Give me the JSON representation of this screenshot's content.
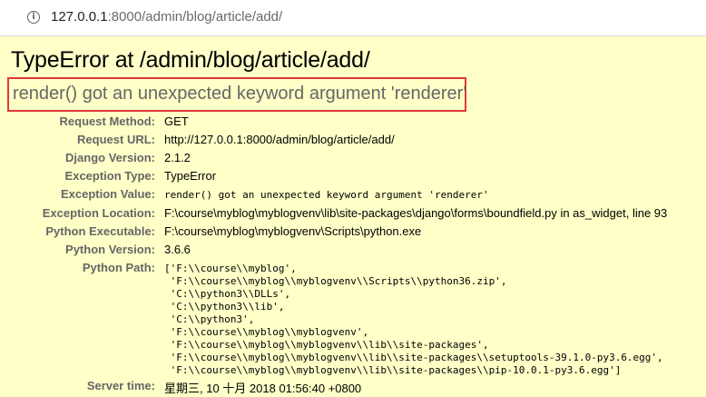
{
  "browser": {
    "url_host": "127.0.0.1",
    "url_rest": ":8000/admin/blog/article/add/"
  },
  "error": {
    "title": "TypeError at /admin/blog/article/add/",
    "message": "render() got an unexpected keyword argument 'renderer'"
  },
  "meta": {
    "request_method": {
      "label": "Request Method:",
      "value": "GET"
    },
    "request_url": {
      "label": "Request URL:",
      "value": "http://127.0.0.1:8000/admin/blog/article/add/"
    },
    "django_version": {
      "label": "Django Version:",
      "value": "2.1.2"
    },
    "exception_type": {
      "label": "Exception Type:",
      "value": "TypeError"
    },
    "exception_value": {
      "label": "Exception Value:",
      "value": "render() got an unexpected keyword argument 'renderer'"
    },
    "exception_location": {
      "label": "Exception Location:",
      "value": "F:\\course\\myblog\\myblogvenv\\lib\\site-packages\\django\\forms\\boundfield.py in as_widget, line 93"
    },
    "python_executable": {
      "label": "Python Executable:",
      "value": "F:\\course\\myblog\\myblogvenv\\Scripts\\python.exe"
    },
    "python_version": {
      "label": "Python Version:",
      "value": "3.6.6"
    },
    "python_path": {
      "label": "Python Path:",
      "lines": [
        "['F:\\\\course\\\\myblog',",
        " 'F:\\\\course\\\\myblog\\\\myblogvenv\\\\Scripts\\\\python36.zip',",
        " 'C:\\\\python3\\\\DLLs',",
        " 'C:\\\\python3\\\\lib',",
        " 'C:\\\\python3',",
        " 'F:\\\\course\\\\myblog\\\\myblogvenv',",
        " 'F:\\\\course\\\\myblog\\\\myblogvenv\\\\lib\\\\site-packages',",
        " 'F:\\\\course\\\\myblog\\\\myblogvenv\\\\lib\\\\site-packages\\\\setuptools-39.1.0-py3.6.egg',",
        " 'F:\\\\course\\\\myblog\\\\myblogvenv\\\\lib\\\\site-packages\\\\pip-10.0.1-py3.6.egg']"
      ]
    },
    "server_time": {
      "label": "Server time:",
      "value": "星期三, 10 十月 2018 01:56:40 +0800"
    }
  }
}
